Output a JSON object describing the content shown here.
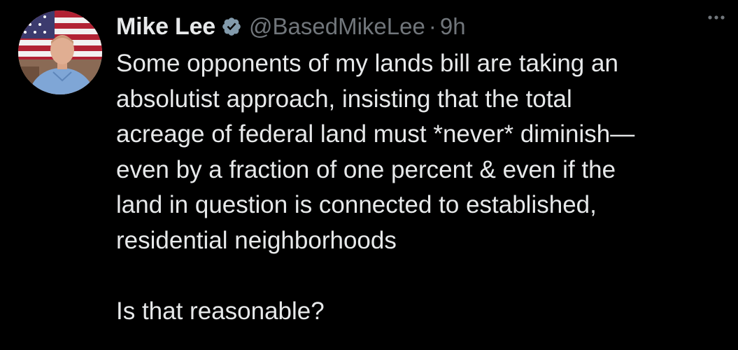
{
  "colors": {
    "background": "#000000",
    "primary_text": "#e7e9ea",
    "secondary_text": "#71767b",
    "verified_badge": "#829aab"
  },
  "tweet": {
    "author": {
      "display_name": "Mike Lee",
      "handle": "@BasedMikeLee",
      "avatar_icon": "profile-photo-with-flag",
      "verified_icon": "verified-badge-icon"
    },
    "separator": "·",
    "timestamp": "9h",
    "more_icon": "more-options-icon",
    "text": "Some opponents of my lands bill are taking an\nabsolutist approach, insisting that the total\nacreage of federal land must *never* diminish—\neven by a fraction of one percent & even if the\nland in question is connected to established,\nresidential neighborhoods\n\nIs that reasonable?"
  }
}
